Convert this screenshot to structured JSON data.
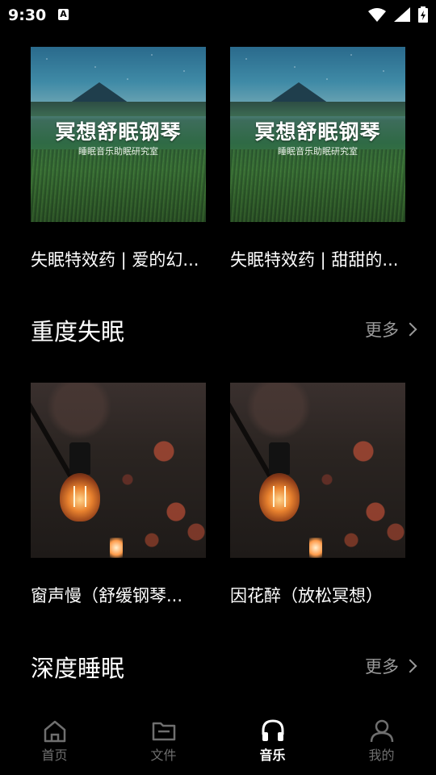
{
  "status_bar": {
    "time": "9:30",
    "notif_glyph": "A"
  },
  "row1": [
    {
      "title": "失眠特效药 | 爱的幻...",
      "cover_title": "冥想舒眠钢琴",
      "cover_sub": "睡眠音乐助眠研究室"
    },
    {
      "title": "失眠特效药 | 甜甜的...",
      "cover_title": "冥想舒眠钢琴",
      "cover_sub": "睡眠音乐助眠研究室"
    }
  ],
  "section1": {
    "title": "重度失眠",
    "more": "更多"
  },
  "row2": [
    {
      "title": "窗声慢（舒缓钢琴..."
    },
    {
      "title": "因花醉（放松冥想）"
    }
  ],
  "section2": {
    "title": "深度睡眠",
    "more": "更多"
  },
  "nav": {
    "items": [
      {
        "label": "首页",
        "icon": "home-icon"
      },
      {
        "label": "文件",
        "icon": "folder-icon"
      },
      {
        "label": "音乐",
        "icon": "headphones-icon",
        "active": true
      },
      {
        "label": "我的",
        "icon": "person-icon"
      }
    ]
  }
}
